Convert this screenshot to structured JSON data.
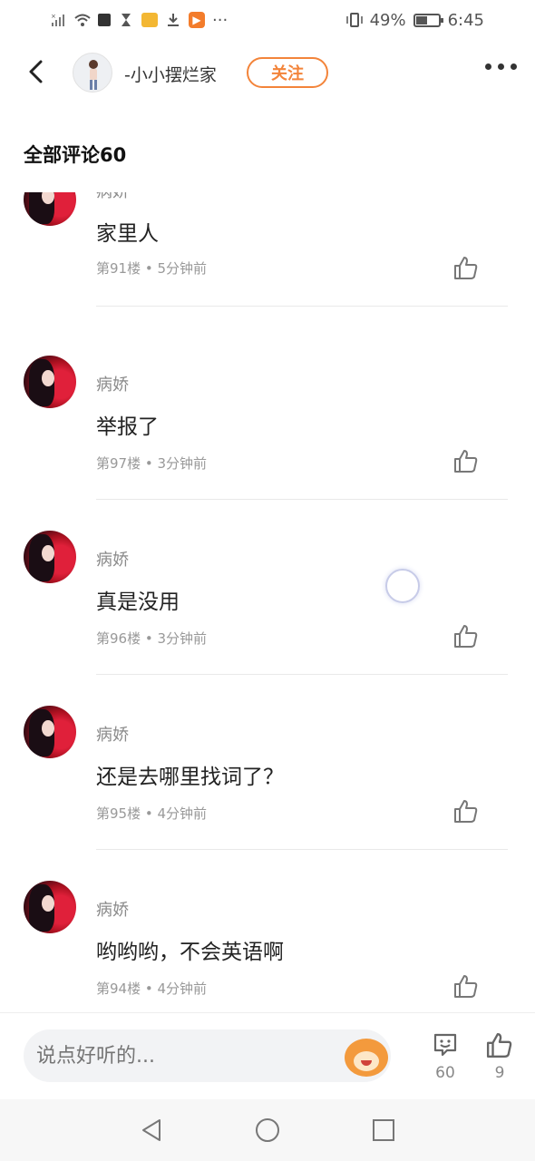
{
  "status_bar": {
    "battery": "49%",
    "time": "6:45",
    "icons": [
      "no-signal-icon",
      "wifi-icon",
      "stop-icon",
      "hourglass-icon",
      "mail-icon",
      "download-icon",
      "video-app-icon",
      "more-dots-icon",
      "vibrate-icon",
      "battery-icon"
    ]
  },
  "header": {
    "author_name": "-小小摆烂家",
    "follow_label": "关注"
  },
  "section": {
    "title": "全部评论60"
  },
  "comments": [
    {
      "user": "病娇",
      "text": "家里人",
      "meta": "第91楼 • 5分钟前"
    },
    {
      "user": "病娇",
      "text": "举报了",
      "meta": "第97楼 • 3分钟前"
    },
    {
      "user": "病娇",
      "text": "真是没用",
      "meta": "第96楼 • 3分钟前"
    },
    {
      "user": "病娇",
      "text": "还是去哪里找词了？",
      "meta": "第95楼 • 4分钟前"
    },
    {
      "user": "病娇",
      "text": "哟哟哟，不会英语啊",
      "meta": "第94楼 • 4分钟前"
    }
  ],
  "bottom_bar": {
    "input_placeholder": "说点好听的...",
    "comment_count": "60",
    "like_count": "9"
  },
  "colors": {
    "accent": "#f3843a",
    "text_primary": "#222222",
    "text_secondary": "#8a8a8a"
  }
}
